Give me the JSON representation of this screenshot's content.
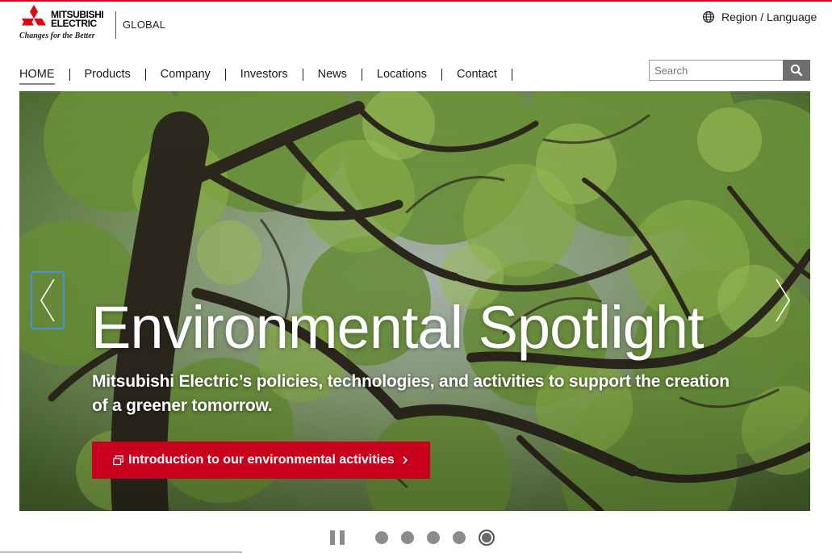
{
  "brand": {
    "name_line1": "MITSUBISHI",
    "name_line2": "ELECTRIC",
    "tagline": "Changes for the Better",
    "site": "GLOBAL",
    "red": "#d9001b"
  },
  "header": {
    "region_label": "Region / Language",
    "region_icon": "globe-icon"
  },
  "nav": {
    "items": [
      {
        "label": "HOME",
        "active": true
      },
      {
        "label": "Products"
      },
      {
        "label": "Company"
      },
      {
        "label": "Investors"
      },
      {
        "label": "News"
      },
      {
        "label": "Locations"
      },
      {
        "label": "Contact"
      }
    ]
  },
  "search": {
    "placeholder": "Search",
    "button_icon": "search-icon"
  },
  "hero": {
    "title": "Environmental Spotlight",
    "subtitle": "Mitsubishi Electric’s policies, technologies, and activities to support the creation of a greener tomorrow.",
    "cta_label": "Introduction to our environmental activities",
    "cta_icon": "external-window-icon",
    "cta_color": "#c8001e",
    "prev_icon": "chevron-left-icon",
    "next_icon": "chevron-right-icon"
  },
  "carousel": {
    "slide_count": 5,
    "active_index": 4,
    "pause_icon": "pause-icon"
  }
}
